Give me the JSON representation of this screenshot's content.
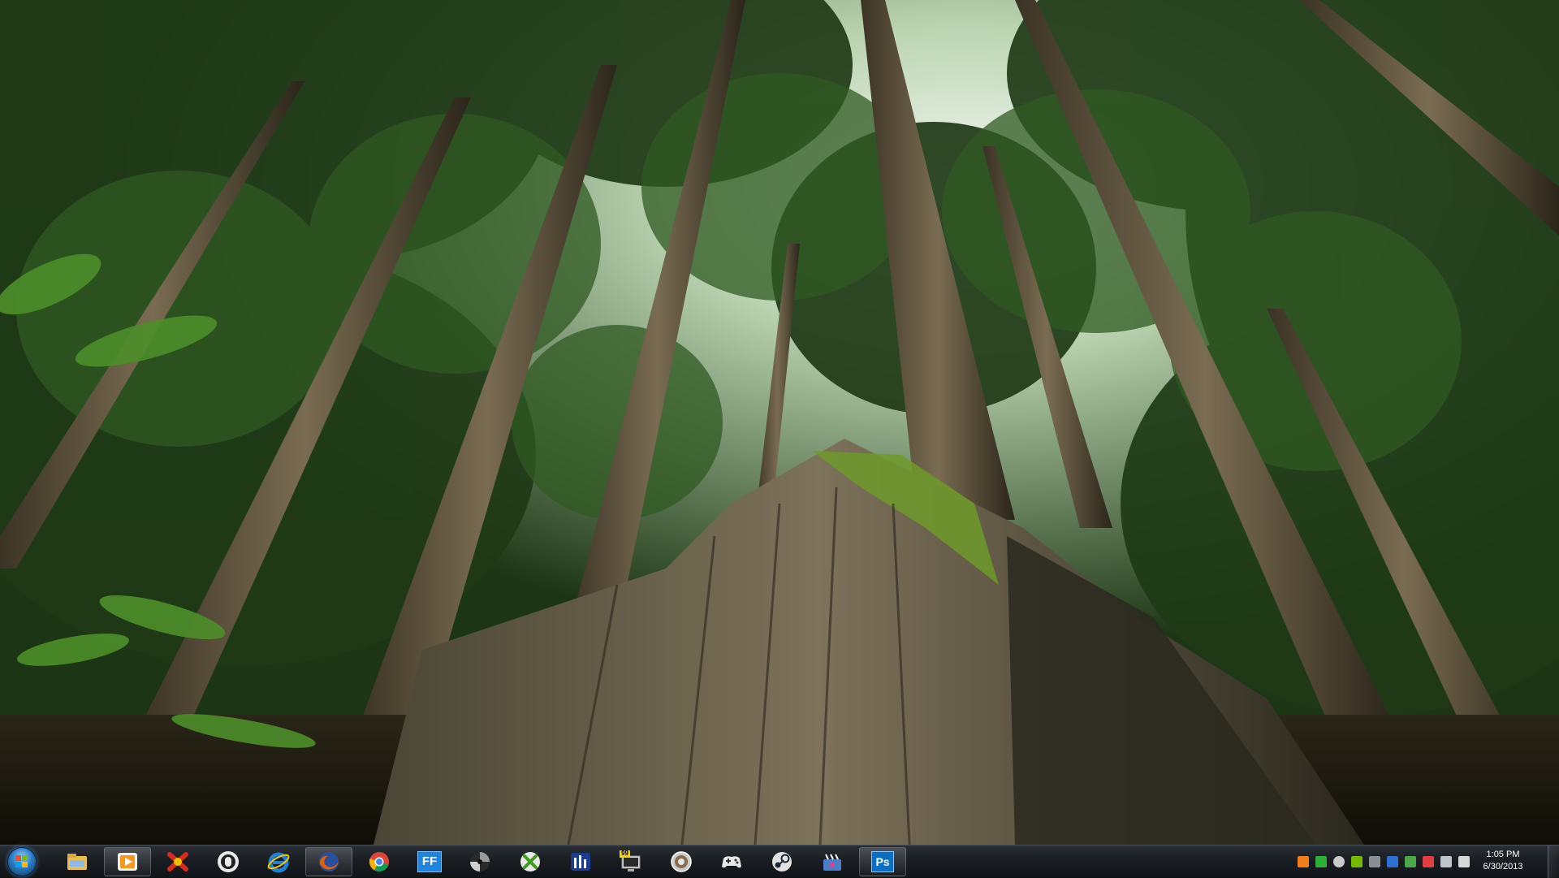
{
  "desktop": {
    "wallpaper_icon": "forest-wallpaper"
  },
  "taskbar": {
    "start_icon": "windows-orb-icon",
    "pinned": [
      {
        "name": "explorer-icon",
        "open": false
      },
      {
        "name": "media-player-icon",
        "open": true
      },
      {
        "name": "xfire-icon",
        "open": false
      },
      {
        "name": "sound-app-icon",
        "open": false
      },
      {
        "name": "internet-explorer-icon",
        "open": false
      },
      {
        "name": "firefox-icon",
        "open": true
      },
      {
        "name": "chrome-icon",
        "open": false
      },
      {
        "name": "ff-app-icon",
        "open": false
      },
      {
        "name": "aperture-icon",
        "open": false
      },
      {
        "name": "xbox-icon",
        "open": false
      },
      {
        "name": "equalizer-icon",
        "open": false
      },
      {
        "name": "monitor-99-icon",
        "open": false
      },
      {
        "name": "disc-icon",
        "open": false
      },
      {
        "name": "gamepad-icon",
        "open": false
      },
      {
        "name": "steam-icon",
        "open": false
      },
      {
        "name": "video-editor-icon",
        "open": false
      },
      {
        "name": "photoshop-icon",
        "open": true
      }
    ],
    "ff_label": "FF",
    "ps_label": "Ps",
    "monitor_label": "99",
    "tray_icons": [
      "orange-app-icon",
      "green-check-icon",
      "steam-tray-icon",
      "nvidia-icon",
      "network-share-icon",
      "keyboard-icon",
      "flag-icon",
      "action-center-icon",
      "display-icon",
      "speaker-icon"
    ],
    "clock": {
      "time": "1:05 PM",
      "date": "6/30/2013"
    }
  },
  "colors": {
    "taskbar": "#1a1e23",
    "firefox_orange": "#e66000",
    "chrome_red": "#db4437",
    "chrome_green": "#0f9d58",
    "chrome_yellow": "#f4b400",
    "ie_blue": "#1e7fd6",
    "photoshop_blue": "#0a6fc1"
  }
}
